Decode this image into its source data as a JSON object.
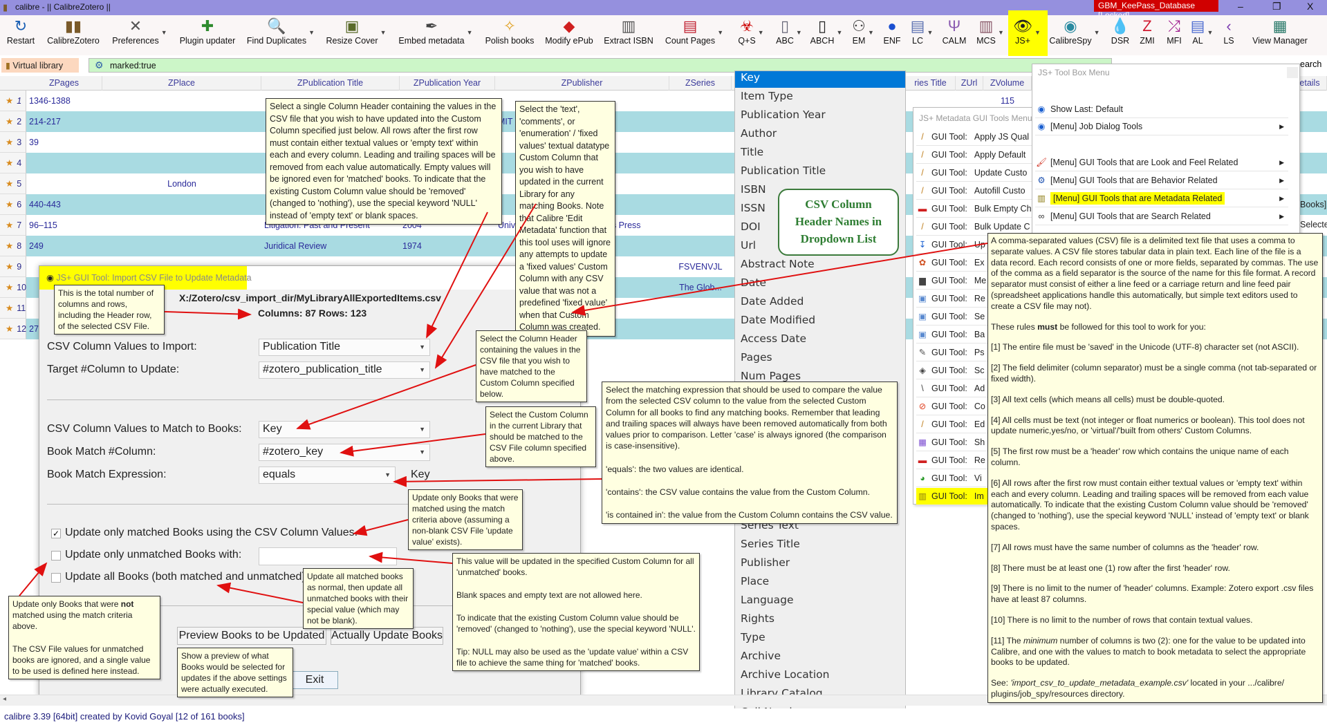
{
  "window": {
    "title": "calibre - || CalibreZotero ||",
    "keepass": "GBM_KeePass_Database [Locked]",
    "minimize": "–",
    "maximize": "❐",
    "close": "X"
  },
  "toolbar": [
    {
      "label": "Restart",
      "icon": "restart-icon",
      "glyph": "↻",
      "color": "#1a5fb4"
    },
    {
      "label": "CalibreZotero",
      "icon": "library-icon",
      "glyph": "▮▮",
      "color": "#7a5a2a"
    },
    {
      "label": "Preferences",
      "icon": "tools-icon",
      "glyph": "✕",
      "color": "#555",
      "dd": true
    },
    {
      "label": "Plugin updater",
      "icon": "puzzle-icon",
      "glyph": "✚",
      "color": "#2e8b2e"
    },
    {
      "label": "Find Duplicates",
      "icon": "find-duplicates-icon",
      "glyph": "🔍",
      "color": "#888",
      "dd": true
    },
    {
      "label": "Resize Cover",
      "icon": "resize-cover-icon",
      "glyph": "▣",
      "color": "#5a6b2a",
      "dd": true
    },
    {
      "label": "Embed metadata",
      "icon": "quill-icon",
      "glyph": "✒",
      "color": "#444",
      "dd": true
    },
    {
      "label": "Polish books",
      "icon": "broom-icon",
      "glyph": "✧",
      "color": "#e0a020"
    },
    {
      "label": "Modify ePub",
      "icon": "modify-epub-icon",
      "glyph": "◆",
      "color": "#d02020"
    },
    {
      "label": "Extract ISBN",
      "icon": "barcode-icon",
      "glyph": "▥",
      "color": "#555"
    },
    {
      "label": "Count Pages",
      "icon": "count-pages-icon",
      "glyph": "▤",
      "color": "#c02030",
      "dd": true
    },
    {
      "label": "Q+S",
      "icon": "biohazard-icon",
      "glyph": "☣",
      "color": "#c00",
      "dd": true
    },
    {
      "label": "ABC",
      "icon": "abc-icon",
      "glyph": "▯",
      "color": "#667",
      "dd": true
    },
    {
      "label": "ABCH",
      "icon": "abch-icon",
      "glyph": "▯",
      "color": "#222",
      "dd": true
    },
    {
      "label": "EM",
      "icon": "hierarchy-icon",
      "glyph": "⚇",
      "color": "#444",
      "dd": true
    },
    {
      "label": "ENF",
      "icon": "chart-circle-icon",
      "glyph": "●",
      "color": "#1a4fd0"
    },
    {
      "label": "LC",
      "icon": "lc-icon",
      "glyph": "▤",
      "color": "#5a6fb0",
      "dd": true
    },
    {
      "label": "CALM",
      "icon": "fork-icon",
      "glyph": "Ψ",
      "color": "#8a5ab0"
    },
    {
      "label": "MCS",
      "icon": "column-icon",
      "glyph": "▥",
      "color": "#8a5a6a",
      "dd": true
    },
    {
      "label": "JS+",
      "icon": "eye-icon",
      "glyph": "👁",
      "color": "#222",
      "dd": true
    },
    {
      "label": "CalibreSpy",
      "icon": "spy-eye-icon",
      "glyph": "◉",
      "color": "#2a8aa0",
      "dd": true
    },
    {
      "label": "DSR",
      "icon": "drop-icon",
      "glyph": "💧",
      "color": "#1a7ad0"
    },
    {
      "label": "ZMI",
      "icon": "zmi-icon",
      "glyph": "Z",
      "color": "#d01a30"
    },
    {
      "label": "MFI",
      "icon": "shuffle-icon",
      "glyph": "⤮",
      "color": "#a02090"
    },
    {
      "label": "AL",
      "icon": "log-file-icon",
      "glyph": "▤",
      "color": "#4a6ad0",
      "dd": true
    },
    {
      "label": "LS",
      "icon": "ls-icon",
      "glyph": "‹",
      "color": "#7a3ab0"
    },
    {
      "label": "View Manager",
      "icon": "view-manager-icon",
      "glyph": "▦",
      "color": "#2a7a6a"
    }
  ],
  "search": {
    "virtual_library": "Virtual library",
    "query": "marked:true",
    "search_partial": "earch"
  },
  "table": {
    "headers": [
      "ZPages",
      "ZPlace",
      "ZPublication Title",
      "ZPublication Year",
      "ZPublisher",
      "ZSeries",
      "ries Title",
      "ZUrl",
      "ZVolume",
      "etails"
    ],
    "rows": [
      {
        "n": "1",
        "pages": "1346-1388",
        "place": "",
        "ptitle": "",
        "year": "",
        "publisher": "",
        "series": "",
        "volume": "115"
      },
      {
        "n": "2",
        "pages": "214-217",
        "place": "",
        "ptitle": "",
        "year": "",
        "publisher": "MIT",
        "series": "",
        "volume": ""
      },
      {
        "n": "3",
        "pages": "39",
        "place": "",
        "ptitle": "",
        "year": "",
        "publisher": "",
        "series": "",
        "volume": ""
      },
      {
        "n": "4",
        "pages": "",
        "place": "",
        "ptitle": "",
        "year": "",
        "publisher": "",
        "series": "",
        "volume": ""
      },
      {
        "n": "5",
        "pages": "",
        "place": "London",
        "ptitle": "",
        "year": "",
        "publisher": "",
        "series": "",
        "volume": ""
      },
      {
        "n": "6",
        "pages": "440-443",
        "place": "",
        "ptitle": "",
        "year": "",
        "publisher": "",
        "series": "",
        "volume": ""
      },
      {
        "n": "7",
        "pages": "96–115",
        "place": "",
        "ptitle": "Litigation: Past and Present",
        "year": "2004",
        "publisher": "University of New South Wales Press",
        "series": "",
        "volume": ""
      },
      {
        "n": "8",
        "pages": "249",
        "place": "",
        "ptitle": "Juridical Review",
        "year": "1974",
        "publisher": "",
        "series": "",
        "volume": ""
      },
      {
        "n": "9",
        "pages": "",
        "place": "",
        "ptitle": "",
        "year": "",
        "publisher": "",
        "series": "FSVENVJL",
        "volume": ""
      },
      {
        "n": "10",
        "pages": "",
        "place": "",
        "ptitle": "",
        "year": "",
        "publisher": "",
        "series": "The Glob...",
        "volume": ""
      },
      {
        "n": "11",
        "pages": "",
        "place": "",
        "ptitle": "",
        "year": "",
        "publisher": "",
        "series": "",
        "volume": ""
      },
      {
        "n": "12",
        "pages": "27",
        "place": "",
        "ptitle": "",
        "year": "",
        "publisher": "",
        "series": "",
        "volume": ""
      }
    ],
    "right_partials": [
      "Books]",
      "Selecte"
    ]
  },
  "dialog": {
    "title": "JS+ GUI Tool:  Import CSV File to Update Metadata",
    "help": "?",
    "close": "X",
    "file_path": "X:/Zotero/csv_import_dir/MyLibraryAllExportedItems.csv",
    "counts": "Columns: 87  Rows: 123",
    "csv_import_label": "CSV Column Values to Import:",
    "csv_import_value": "Publication Title",
    "target_label": "Target #Column to Update:",
    "target_value": "#zotero_publication_title",
    "match_csv_label": "CSV Column Values to Match to Books:",
    "match_csv_value": "Key",
    "match_col_label": "Book Match #Column:",
    "match_col_value": "#zotero_key",
    "expr_label": "Book Match Expression:",
    "expr_value": "equals",
    "expr_key": "Key",
    "opt_matched": "Update only matched Books using the CSV Column Values.",
    "opt_matched_checked": true,
    "opt_unmatched": "Update only unmatched Books with:",
    "opt_unmatched_value": "",
    "opt_all": "Update all Books (both matched and unmatched).",
    "preview_button": "Preview Books to be Updated",
    "update_button": "Actually Update Books",
    "exit_button": "Exit"
  },
  "dropdown": {
    "top": [
      "Key",
      "Item Type",
      "Publication Year",
      "Author",
      "Title",
      "Publication Title",
      "ISBN",
      "ISSN",
      "DOI",
      "Url",
      "Abstract Note",
      "Date",
      "Date Added",
      "Date Modified",
      "Access Date",
      "Pages",
      "Num Pages"
    ],
    "bottom": [
      "Series Text",
      "Series Title",
      "Publisher",
      "Place",
      "Language",
      "Rights",
      "Type",
      "Archive",
      "Archive Location",
      "Library Catalog",
      "Call Number"
    ]
  },
  "callout": [
    "CSV Column",
    "Header Names in",
    "Dropdown List"
  ],
  "toolbox_menu": {
    "header": "JS+ Tool Box Menu",
    "items": [
      {
        "label": "Show Last: Default",
        "icon": "eye-icon",
        "glyph": "◉",
        "color": "#1a5fd0",
        "sub": false,
        "y": 157
      },
      {
        "label": "[Menu] Job Dialog Tools",
        "icon": "eye-icon",
        "glyph": "◉",
        "color": "#1a5fd0",
        "sub": true,
        "y": 182
      },
      {
        "label": "[Menu] GUI Tools that are Look and Feel Related",
        "icon": "paintbrush-icon",
        "glyph": "🖌",
        "color": "#d03020",
        "sub": true,
        "y": 234
      },
      {
        "label": "[Menu] GUI Tools that are Behavior Related",
        "icon": "gear-icon",
        "glyph": "⚙",
        "color": "#1a4fb0",
        "sub": true,
        "y": 260
      },
      {
        "label": "[Menu] GUI Tools that are Metadata Related",
        "icon": "column-icon",
        "glyph": "▥",
        "color": "#8a7a10",
        "sub": true,
        "y": 286,
        "hl": true
      },
      {
        "label": "[Menu] GUI Tools that are Search Related",
        "icon": "binoculars-icon",
        "glyph": "∞",
        "color": "#333",
        "sub": true,
        "y": 312
      }
    ]
  },
  "metadata_menu": {
    "header": "JS+ Metadata GUI Tools Menu",
    "prefix": "GUI Tool:",
    "items": [
      {
        "label": "Apply JS Qual",
        "glyph": "/",
        "color": "#c08020"
      },
      {
        "label": "Apply Default",
        "glyph": "/",
        "color": "#c08020"
      },
      {
        "label": "Update Custo",
        "glyph": "/",
        "color": "#c08020"
      },
      {
        "label": "Autofill Custo",
        "glyph": "/",
        "color": "#c08020"
      },
      {
        "label": "Bulk Empty Ch",
        "glyph": "▬",
        "color": "#d02020"
      },
      {
        "label": "Bulk Update C",
        "glyph": "/",
        "color": "#c08020"
      },
      {
        "label": "Up",
        "glyph": "↧",
        "color": "#1a5fd0"
      },
      {
        "label": "Ex",
        "glyph": "✿",
        "color": "#d05020"
      },
      {
        "label": "Me",
        "glyph": "▆",
        "color": "#444"
      },
      {
        "label": "Re",
        "glyph": "▣",
        "color": "#5a8ad0"
      },
      {
        "label": "Se",
        "glyph": "▣",
        "color": "#5a8ad0"
      },
      {
        "label": "Ba",
        "glyph": "▣",
        "color": "#5a8ad0"
      },
      {
        "label": "Ps",
        "glyph": "✎",
        "color": "#555"
      },
      {
        "label": "Sc",
        "glyph": "◈",
        "color": "#444"
      },
      {
        "label": "Ad",
        "glyph": "\\",
        "color": "#444"
      },
      {
        "label": "Co",
        "glyph": "⊘",
        "color": "#e04020"
      },
      {
        "label": "Ed",
        "glyph": "/",
        "color": "#c08020"
      },
      {
        "label": "Sh",
        "glyph": "▦",
        "color": "#7a4ad0"
      },
      {
        "label": "Re",
        "glyph": "▬",
        "color": "#d02020"
      },
      {
        "label": "Vi",
        "glyph": "◕",
        "color": "#2a9a2a"
      },
      {
        "label": "Im",
        "glyph": "▥",
        "color": "#8a7a10",
        "hl": true
      }
    ]
  },
  "tooltips": {
    "csv_import": [
      "Select a single Column Header containing the values in the CSV file that you wish to have updated into the Custom Column specified just below. All rows after the first row must contain either textual values or 'empty text' within each and every column. Leading and trailing spaces will be removed from each value automatically. Empty values will be ignored even for 'matched' books. To indicate that the existing Custom Column value should be 'removed' (changed to 'nothing'), use the special keyword 'NULL' instead of 'empty text' or blank spaces."
    ],
    "target": [
      "Select the 'text', 'comments', or 'enumeration' / 'fixed values' textual datatype Custom Column that you wish to have updated in the current Library for any matching Books. Note that Calibre 'Edit Metadata' function that this tool uses will ignore any attempts to update a 'fixed values' Custom Column with any CSV value that was not a predefined 'fixed value' when that Custom Column was created."
    ],
    "counts": [
      "This is the total number of columns and rows, including the Header row, of the selected CSV File."
    ],
    "match_csv": [
      "Select the Column Header containing the values in the CSV file that you wish to have matched to the Custom Column specified below."
    ],
    "match_col": [
      "Select the Custom Column in the current Library that should be matched to the CSV File column specified above."
    ],
    "expression": [
      "Select the matching expression that should be used to compare the value from the selected CSV column to the value from the selected Custom Column for all books to find any matching books. Remember that leading and trailing spaces will always have been removed automatically from both values prior to comparison. Letter 'case' is always ignored (the comparison is case-insensitive).",
      "'equals': the two values are identical.",
      "'contains': the CSV value contains the value from the Custom Column.",
      "'is contained in': the value from the Custom Column contains the CSV value."
    ],
    "matched": [
      "Update only Books that were matched using the match criteria above (assuming a non-blank CSV File 'update value' exists)."
    ],
    "unmatched_value": [
      "This value will be updated in the specified Custom Column for all 'unmatched' books.",
      "Blank spaces and empty text are not allowed here.",
      "To indicate that the existing Custom Column value should be 'removed' (changed to 'nothing'), use the special keyword 'NULL'.",
      "Tip: NULL may also be used as the 'update value' within a CSV file to achieve the same thing for 'matched' books."
    ],
    "all_books": [
      "Update all matched books as normal, then update all unmatched books with their special value (which may not be blank)."
    ],
    "not_matched": {
      "pre": "Update only Books that were ",
      "bold": "not",
      "post": " matched using the match criteria above.",
      "p2": "The CSV File values for unmatched books are ignored, and a single value to be used is defined here instead."
    },
    "preview": [
      "Show a preview of what Books would be selected for updates if the above settings were actually executed."
    ],
    "csv_rules": {
      "intro": "A comma-separated values (CSV) file is a delimited text file that uses a comma to separate values. A CSV file stores tabular data in plain text. Each line of the file is a data record. Each record consists of one or more fields, separated by commas. The use of the comma as a field separator is the source of the name for this file format. A record separator must consist of either a line feed or a carriage return and line feed pair (spreadsheet applications handle this automatically, but simple text editors used to create a CSV file may not).",
      "rules_pre": "These rules ",
      "rules_bold": "must",
      "rules_post": " be followed for this tool to work for you:",
      "rules": [
        "[1] The entire file must be 'saved' in the Unicode (UTF-8) character set (not ASCII).",
        "[2] The field delimiter (column separator) must be a single comma (not tab-separated or fixed width).",
        "[3] All text cells (which means all cells) must be double-quoted.",
        "[4] All cells must be text (not integer or float numerics or boolean). This tool does not update numeric,yes/no, or 'virtual'/'built from others' Custom Columns.",
        "[5] The first row must be a 'header' row which contains the unique name of each column.",
        "[6] All rows after the first row must contain either textual values or 'empty text' within each and every column. Leading and trailing spaces will be removed from each value automatically. To indicate that the existing Custom Column value should be 'removed' (changed to 'nothing'), use the special keyword 'NULL' instead of 'empty text' or blank spaces.",
        "[7] All rows must have the same number of columns as the 'header' row.",
        "[8] There must be at least one (1) row after the first 'header' row.",
        "[9] There is no limit to the numer of 'header' columns. Example: Zotero export .csv files have at least 87 columns.",
        "[10] There is no limit to the number of rows that contain textual values."
      ],
      "r11_pre": "[11] The ",
      "r11_em": "minimum",
      "r11_post": " number of columns is two (2): one for the value to be updated into Calibre, and one with the values to match to book metadata to select the appropriate books to be updated.",
      "see_pre": "See: ",
      "see_em": "'import_csv_to_update_metadata_example.csv'",
      "see_post": " located in your .../calibre/ plugins/job_spy/resources directory."
    }
  },
  "status": {
    "text": "calibre 3.39 [64bit] created by Kovid Goyal    [12 of 161 books]"
  }
}
